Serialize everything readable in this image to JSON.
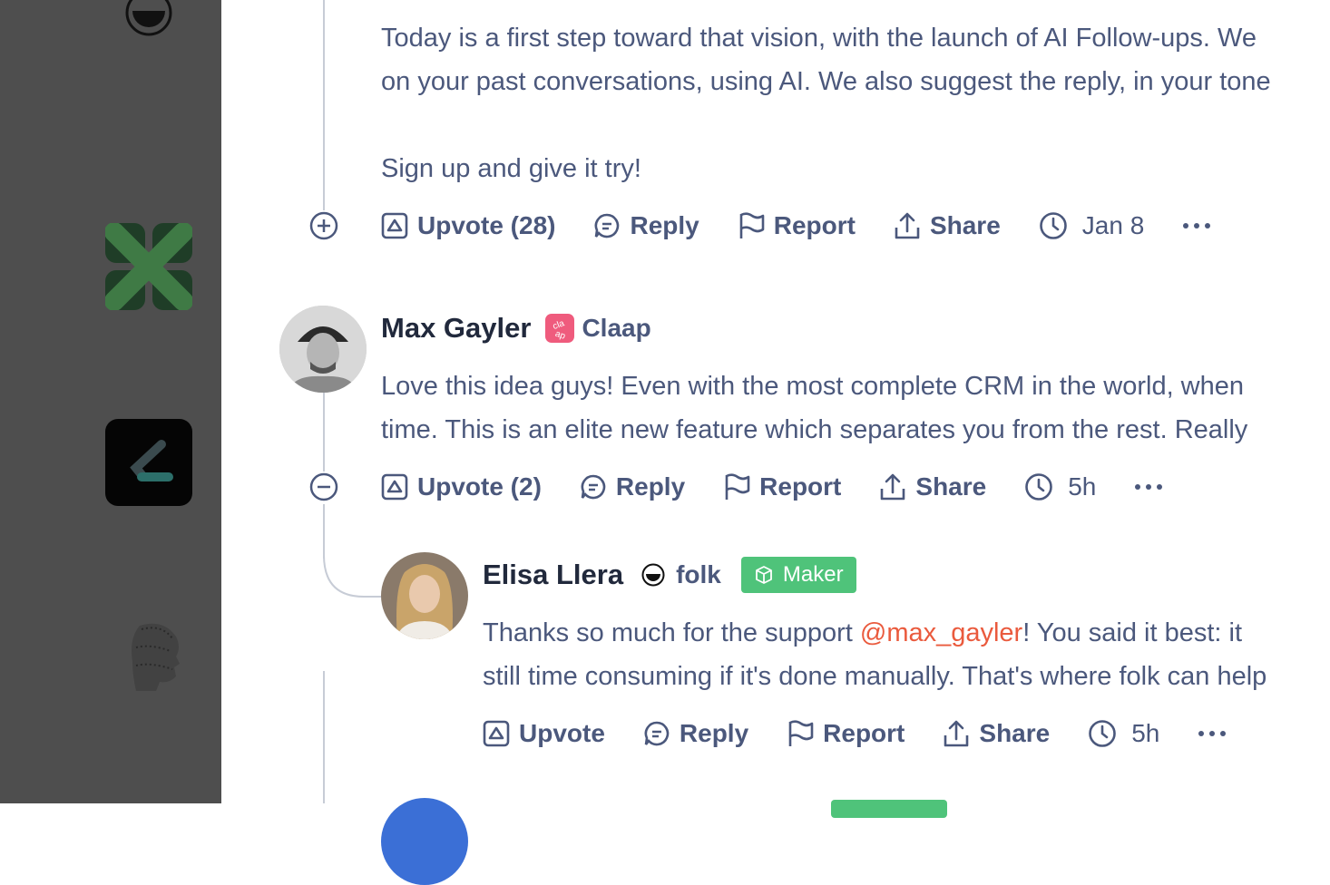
{
  "sidebar": {
    "icons": [
      "folk-logo-icon",
      "green-clover-logo-icon",
      "dark-k-logo-icon",
      "dotted-head-logo-icon"
    ]
  },
  "comments": [
    {
      "text_lines": [
        "Today is a first step toward that vision, with the launch of AI Follow-ups. We",
        "on your past conversations, using AI. We also suggest the reply, in your tone",
        "",
        "Sign up and give it try!"
      ],
      "actions": {
        "upvote": "Upvote (28)",
        "reply": "Reply",
        "report": "Report",
        "share": "Share",
        "time": "Jan 8"
      }
    },
    {
      "author": "Max Gayler",
      "company": "Claap",
      "text_lines": [
        "Love this idea guys! Even with the most complete CRM in the world, when",
        "time. This is an elite new feature which separates you from the rest. Really"
      ],
      "actions": {
        "upvote": "Upvote (2)",
        "reply": "Reply",
        "report": "Report",
        "share": "Share",
        "time": "5h"
      }
    },
    {
      "author": "Elisa Llera",
      "company": "folk",
      "badge": "Maker",
      "text_line1_before": "Thanks so much for the support ",
      "mention": "@max_gayler",
      "text_line1_after": "! You said it best: it",
      "text_line2": "still time consuming if it's done manually. That's where folk can help",
      "actions": {
        "upvote": "Upvote",
        "reply": "Reply",
        "report": "Report",
        "share": "Share",
        "time": "5h"
      }
    }
  ],
  "colors": {
    "sidebar_bg": "#4e4e4e",
    "text": "#4b587c",
    "name": "#21293c",
    "mention": "#ea5a3d",
    "maker_badge": "#4fc37a"
  }
}
